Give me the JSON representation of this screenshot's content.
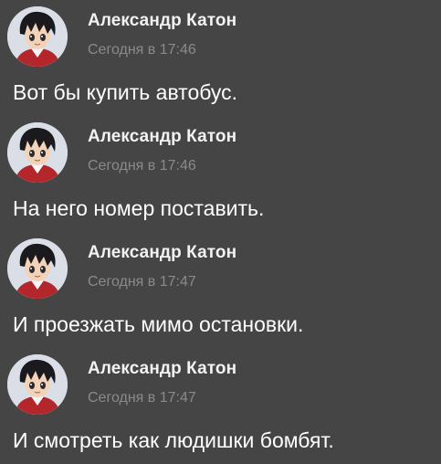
{
  "messages": [
    {
      "author": "Александр Катон",
      "time": "Сегодня в 17:46",
      "text": "Вот бы купить автобус.",
      "avatar_icon": "anime-character-avatar"
    },
    {
      "author": "Александр Катон",
      "time": "Сегодня в 17:46",
      "text": "На него номер поставить.",
      "avatar_icon": "anime-character-avatar"
    },
    {
      "author": "Александр Катон",
      "time": "Сегодня в 17:47",
      "text": "И проезжать мимо остановки.",
      "avatar_icon": "anime-character-avatar"
    },
    {
      "author": "Александр Катон",
      "time": "Сегодня в 17:47",
      "text": "И смотреть как людишки бомбят.",
      "avatar_icon": "anime-character-avatar"
    }
  ],
  "colors": {
    "background": "#454545",
    "author": "#f2f2f2",
    "time": "#8a8a8a",
    "text": "#ffffff"
  }
}
